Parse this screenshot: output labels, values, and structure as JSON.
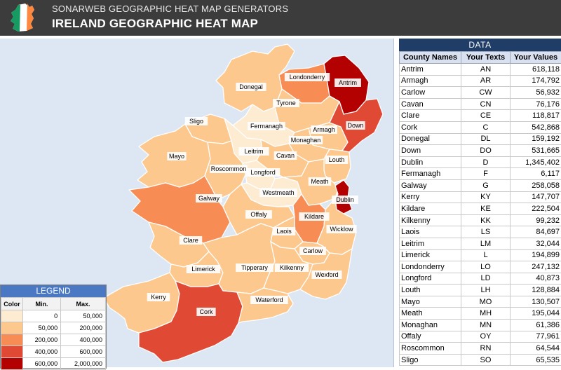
{
  "header": {
    "subtitle": "SONARWEB GEOGRAPHIC HEAT MAP GENERATORS",
    "title": "IRELAND GEOGRAPHIC HEAT MAP",
    "logo_icon": "ireland-flag-map-icon"
  },
  "colors": {
    "header_bg": "#3c3c3c",
    "sea": "#dde6f3",
    "legend_header": "#4a78c2",
    "data_header": "#1f3d66",
    "scale": [
      "#fdebd2",
      "#fdc88e",
      "#f88c55",
      "#e04a35",
      "#b30000"
    ]
  },
  "legend": {
    "title": "LEGEND",
    "col_color": "Color",
    "col_min": "Min.",
    "col_max": "Max.",
    "rows": [
      {
        "min": "0",
        "max": "50,000",
        "color": "#fdebd2"
      },
      {
        "min": "50,000",
        "max": "200,000",
        "color": "#fdc88e"
      },
      {
        "min": "200,000",
        "max": "400,000",
        "color": "#f88c55"
      },
      {
        "min": "400,000",
        "max": "600,000",
        "color": "#e04a35"
      },
      {
        "min": "600,000",
        "max": "2,000,000",
        "color": "#b30000"
      }
    ]
  },
  "data_table": {
    "title": "DATA",
    "headers": [
      "County Names",
      "Your Texts",
      "Your Values"
    ],
    "rows": [
      [
        "Antrim",
        "AN",
        "618,118"
      ],
      [
        "Armagh",
        "AR",
        "174,792"
      ],
      [
        "Carlow",
        "CW",
        "56,932"
      ],
      [
        "Cavan",
        "CN",
        "76,176"
      ],
      [
        "Clare",
        "CE",
        "118,817"
      ],
      [
        "Cork",
        "C",
        "542,868"
      ],
      [
        "Donegal",
        "DL",
        "159,192"
      ],
      [
        "Down",
        "DO",
        "531,665"
      ],
      [
        "Dublin",
        "D",
        "1,345,402"
      ],
      [
        "Fermanagh",
        "F",
        "6,117"
      ],
      [
        "Galway",
        "G",
        "258,058"
      ],
      [
        "Kerry",
        "KY",
        "147,707"
      ],
      [
        "Kildare",
        "KE",
        "222,504"
      ],
      [
        "Kilkenny",
        "KK",
        "99,232"
      ],
      [
        "Laois",
        "LS",
        "84,697"
      ],
      [
        "Leitrim",
        "LM",
        "32,044"
      ],
      [
        "Limerick",
        "L",
        "194,899"
      ],
      [
        "Londonderry",
        "LO",
        "247,132"
      ],
      [
        "Longford",
        "LD",
        "40,873"
      ],
      [
        "Louth",
        "LH",
        "128,884"
      ],
      [
        "Mayo",
        "MO",
        "130,507"
      ],
      [
        "Meath",
        "MH",
        "195,044"
      ],
      [
        "Monaghan",
        "MN",
        "61,386"
      ],
      [
        "Offaly",
        "OY",
        "77,961"
      ],
      [
        "Roscommon",
        "RN",
        "64,544"
      ],
      [
        "Sligo",
        "SO",
        "65,535"
      ]
    ]
  },
  "map": {
    "counties": [
      {
        "name": "Antrim",
        "label": "Antrim",
        "color": "#b30000"
      },
      {
        "name": "Londonderry",
        "label": "Londonderry",
        "color": "#f88c55"
      },
      {
        "name": "Donegal",
        "label": "Donegal",
        "color": "#fdc88e"
      },
      {
        "name": "Tyrone",
        "label": "Tyrone",
        "color": "#fdc88e"
      },
      {
        "name": "Down",
        "label": "Down",
        "color": "#e04a35"
      },
      {
        "name": "Armagh",
        "label": "Armagh",
        "color": "#fdc88e"
      },
      {
        "name": "Fermanagh",
        "label": "Fermanagh",
        "color": "#fdebd2"
      },
      {
        "name": "Monaghan",
        "label": "Monaghan",
        "color": "#fdc88e"
      },
      {
        "name": "Sligo",
        "label": "Sligo",
        "color": "#fdc88e"
      },
      {
        "name": "Leitrim",
        "label": "Leitrim",
        "color": "#fdebd2"
      },
      {
        "name": "Cavan",
        "label": "Cavan",
        "color": "#fdc88e"
      },
      {
        "name": "Louth",
        "label": "Louth",
        "color": "#fdc88e"
      },
      {
        "name": "Mayo",
        "label": "Mayo",
        "color": "#fdc88e"
      },
      {
        "name": "Roscommon",
        "label": "Roscommon",
        "color": "#fdc88e"
      },
      {
        "name": "Longford",
        "label": "Longford",
        "color": "#fdebd2"
      },
      {
        "name": "Westmeath",
        "label": "Westmeath",
        "color": "#fdebd2"
      },
      {
        "name": "Meath",
        "label": "Meath",
        "color": "#fdc88e"
      },
      {
        "name": "Dublin",
        "label": "Dublin",
        "color": "#b30000"
      },
      {
        "name": "Galway",
        "label": "Galway",
        "color": "#f88c55"
      },
      {
        "name": "Offaly",
        "label": "Offaly",
        "color": "#fdc88e"
      },
      {
        "name": "Kildare",
        "label": "Kildare",
        "color": "#f88c55"
      },
      {
        "name": "Laois",
        "label": "Laois",
        "color": "#fdc88e"
      },
      {
        "name": "Wicklow",
        "label": "Wicklow",
        "color": "#fdc88e"
      },
      {
        "name": "Clare",
        "label": "Clare",
        "color": "#fdc88e"
      },
      {
        "name": "Carlow",
        "label": "Carlow",
        "color": "#fdc88e"
      },
      {
        "name": "Limerick",
        "label": "Limerick",
        "color": "#fdc88e"
      },
      {
        "name": "Tipperary",
        "label": "Tipperary",
        "color": "#fdc88e"
      },
      {
        "name": "Kilkenny",
        "label": "Kilkenny",
        "color": "#fdc88e"
      },
      {
        "name": "Wexford",
        "label": "Wexford",
        "color": "#fdc88e"
      },
      {
        "name": "Kerry",
        "label": "Kerry",
        "color": "#fdc88e"
      },
      {
        "name": "Cork",
        "label": "Cork",
        "color": "#e04a35"
      },
      {
        "name": "Waterford",
        "label": "Waterford",
        "color": "#fdc88e"
      }
    ]
  }
}
